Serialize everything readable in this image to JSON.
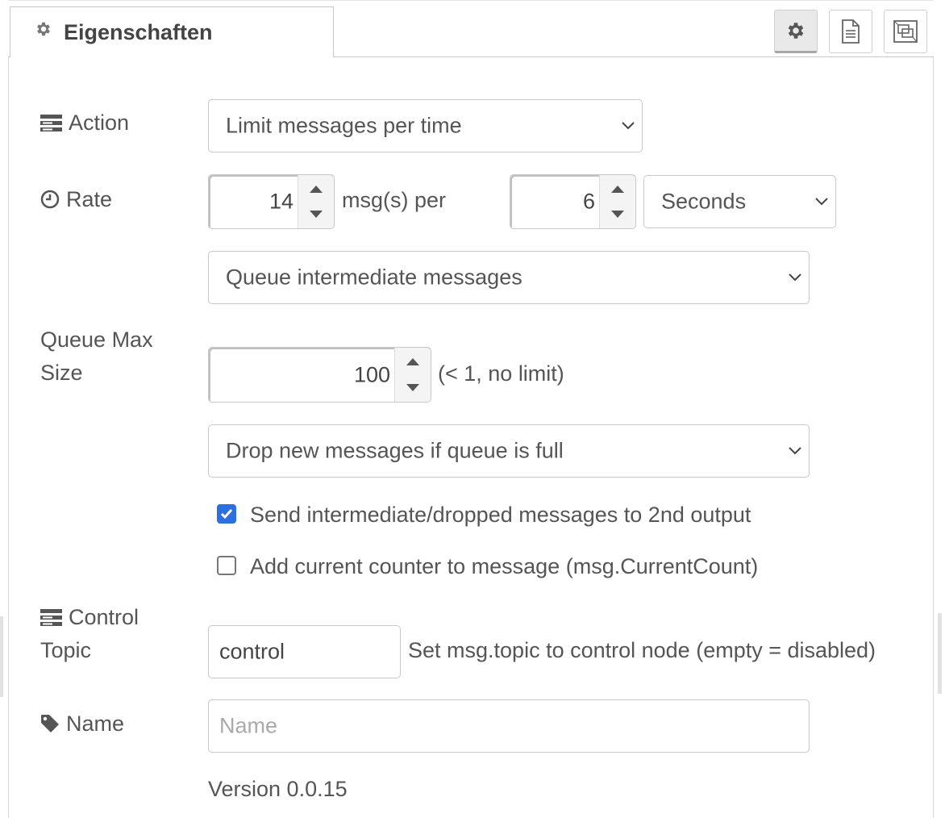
{
  "tab": {
    "label": "Eigenschaften",
    "icon": "gear-icon"
  },
  "toolbar": {
    "buttons": [
      {
        "name": "settings",
        "icon": "gear-icon",
        "active": true
      },
      {
        "name": "description",
        "icon": "document-icon",
        "active": false
      },
      {
        "name": "appearance",
        "icon": "layout-frame-icon",
        "active": false
      }
    ]
  },
  "form": {
    "action": {
      "label": "Action",
      "icon": "list-icon",
      "value": "Limit messages per time"
    },
    "rate": {
      "label": "Rate",
      "icon": "clock-icon",
      "count": "14",
      "per_text": "msg(s) per",
      "period": "6",
      "unit": "Seconds"
    },
    "queue_mode": {
      "value": "Queue intermediate messages"
    },
    "queue_max": {
      "label_line1": "Queue Max",
      "label_line2": "Size",
      "value": "100",
      "hint": "(< 1, no limit)"
    },
    "drop_mode": {
      "value": "Drop new messages if queue is full"
    },
    "send_second_output": {
      "label": "Send intermediate/dropped messages to 2nd output",
      "checked": true
    },
    "add_counter": {
      "label": "Add current counter to message (msg.CurrentCount)",
      "checked": false
    },
    "control_topic": {
      "label_line1": "Control",
      "label_line2": "Topic",
      "icon": "list-icon",
      "value": "control",
      "hint": "Set msg.topic to control node (empty = disabled)"
    },
    "name": {
      "label": "Name",
      "icon": "tag-icon",
      "placeholder": "Name",
      "value": ""
    },
    "version": "Version 0.0.15"
  },
  "colors": {
    "checkbox_accent": "#2b6fe0",
    "text": "#555555"
  }
}
